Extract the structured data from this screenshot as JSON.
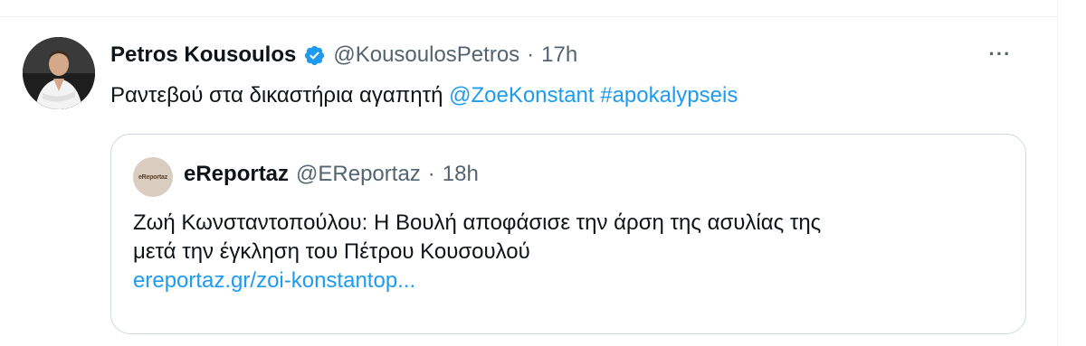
{
  "tweet": {
    "author_name": "Petros Kousoulos",
    "handle": "@KousoulosPetros",
    "separator": "·",
    "time": "17h",
    "more_label": "···",
    "text_plain": "Ραντεβού στα δικαστήρια αγαπητή ",
    "mention": "@ZoeKonstant",
    "hashtag": "#apokalypseis",
    "verified_icon": "verified-badge-icon",
    "accent_color": "#1d9bf0"
  },
  "quote": {
    "author_name": "eReportaz",
    "handle": "@EReportaz",
    "separator": "·",
    "time": "18h",
    "logo_text": "eReportaz",
    "text_line1": "Ζωή Κωνσταντοπούλου: Η Βουλή αποφάσισε την άρση της ασυλίας της",
    "text_line2": "μετά την έγκληση του Πέτρου Κουσουλού",
    "link": "ereportaz.gr/zoi-konstantop..."
  }
}
